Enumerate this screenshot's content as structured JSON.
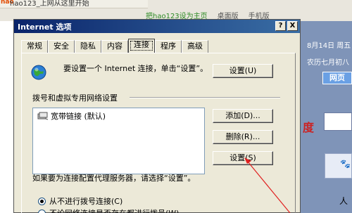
{
  "background": {
    "tab_title": "hao123_上网从这里开始",
    "links": [
      "把hao123设为主页",
      "桌面版",
      "手机版"
    ],
    "date_text": "8月14日 周五",
    "lunar_text": "农历七月初八",
    "web_button": "网页",
    "red_char": "度",
    "bottom_char": "人",
    "accent_color": "#7f94b8"
  },
  "dialog": {
    "title": "Internet 选项",
    "help_button": "?",
    "close_button": "X",
    "tabs": [
      "常规",
      "安全",
      "隐私",
      "内容",
      "连接",
      "程序",
      "高级"
    ],
    "active_tab": "连接",
    "setup_text": "要设置一个 Internet 连接，单击“设置”。",
    "setup_button": "设置(U)",
    "dialup_group_label": "拨号和虚拟专用网络设置",
    "connections": [
      "宽带链接 (默认)"
    ],
    "add_button": "添加(D)...",
    "delete_button": "删除(R)...",
    "settings_button": "设置(S)",
    "proxy_text": "如果要为连接配置代理服务器，请选择“设置”。",
    "radio_options": [
      "从不进行拨号连接(C)",
      "不论网络连接是否存在都进行拨号(W)"
    ],
    "radio_selected": 0
  }
}
